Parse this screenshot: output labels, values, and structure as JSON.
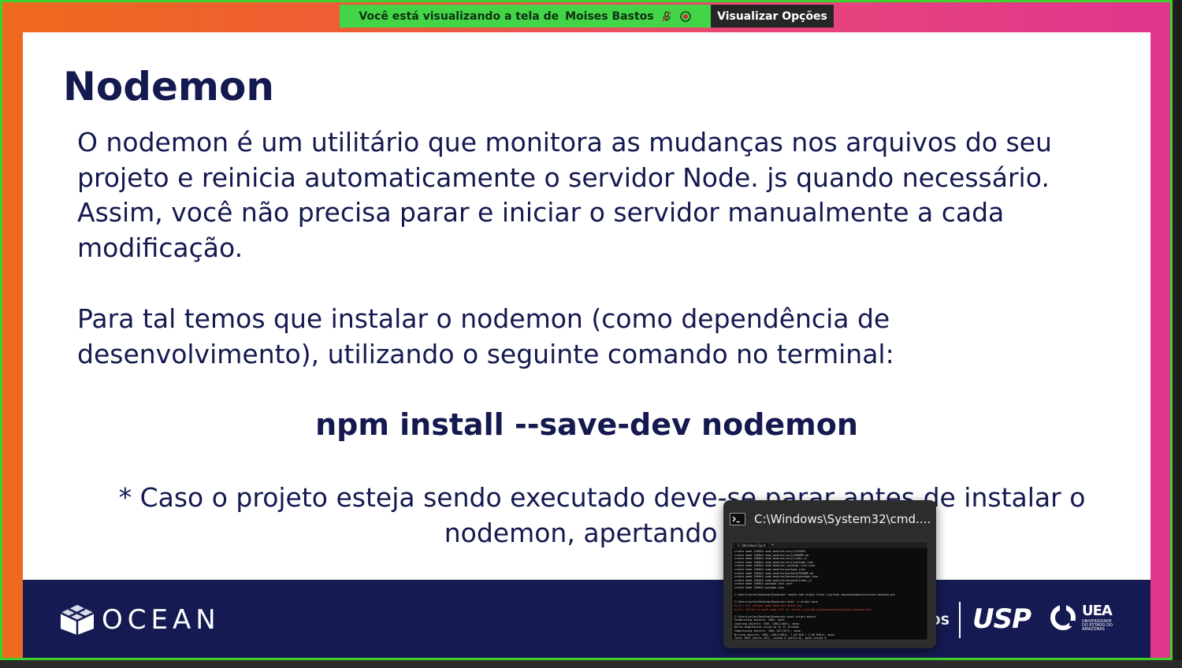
{
  "share_banner": {
    "text": "Você está visualizando a tela de",
    "presenter": "Moises Bastos",
    "view_options_label": "Visualizar Opções",
    "color": "#43d448"
  },
  "slide": {
    "title": "Nodemon",
    "paragraph_1": "O nodemon é um utilitário que monitora as mudanças nos arquivos do seu projeto e reinicia automaticamente o servidor Node. js quando necessário. Assim, você não precisa parar e iniciar o servidor manualmente a cada modificação.",
    "paragraph_2": "Para tal temos que instalar o nodemon (como dependência de desenvolvimento), utilizando o seguinte comando no terminal:",
    "command": "npm install --save-dev nodemon",
    "note": "* Caso o projeto esteja sendo executado deve-se parar antes de instalar o nodemon, apertando CT",
    "text_color": "#14194f"
  },
  "footer": {
    "ocean_label": "OCEAN",
    "partner_fragment": "OS",
    "usp_label": "USP",
    "uea_label": "UEA",
    "uea_sub": "UNIVERSIDADE DO ESTADO DO AMAZONAS",
    "background": "#151b52"
  },
  "cmd_window": {
    "title": "C:\\Windows\\System32\\cmd....",
    "tab_label": "C:\\Windows\\Syst",
    "icon": "terminal-icon",
    "lines": [
      "create mode 100644 node_modules/vary/LICENSE",
      "create mode 100644 node_modules/vary/README.md",
      "create mode 100644 node_modules/vary/index.js",
      "create mode 100644 node_modules/vary/package.json",
      "create mode 100644 node_modules/.package-lock.json",
      "create mode 100644 node_modules/package.json",
      "create mode 100644 node_modules/backend/README.md",
      "create mode 100644 node_modules/backend/package.json",
      "create mode 100644 node_modules/backend/index.js",
      "create mode 100644 package-lock.json",
      "create mode 100644 package.json",
      "",
      "C:\\Users\\aulas\\Desktop\\Ocean>git remote add origin https://github.com/moisesbastos/ocean-backend.git",
      "",
      "C:\\Users\\aulas\\Desktop\\Ocean>git push -u origin main",
      "error: src refspec main does not match any",
      "error: failed to push some refs to 'https://github.com/moisesbastos/ocean-backend.git'",
      "",
      "C:\\Users\\aulas\\Desktop\\Ocean>git push origin master",
      "Enumerating objects: 1001, done.",
      "Counting objects: 100% (1001/1001), done.",
      "Delta compression using up to 12 threads",
      "Compressing objects: 100% (877/877), done.",
      "Writing objects: 100% (1001/1001), 1.84 MiB | 2.06 MiB/s, done.",
      "Total 1001 (delta 107), reused 0 (delta 0), pack-reused 0",
      "remote: Resolving deltas: 100% (107/107), done.",
      "To https://github.com/moisesbastos/ocean-backend.git",
      " * [new branch]      master -> master",
      "",
      "C:\\Users\\aulas\\Desktop\\Ocean>"
    ]
  },
  "colors": {
    "gradient_left": "#ee6a1c",
    "gradient_right": "#e0348e",
    "presenter_border": "#3fcf2f"
  }
}
